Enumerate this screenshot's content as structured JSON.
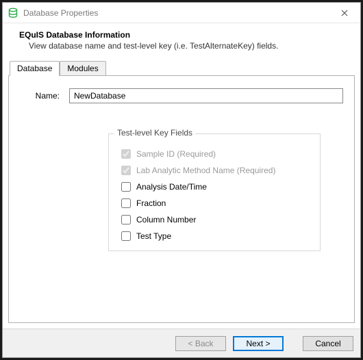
{
  "window": {
    "title": "Database Properties"
  },
  "header": {
    "title": "EQuIS Database Information",
    "subtitle": "View database name and test-level key (i.e. TestAlternateKey) fields."
  },
  "tabs": {
    "items": [
      {
        "label": "Database",
        "active": true
      },
      {
        "label": "Modules",
        "active": false
      }
    ]
  },
  "form": {
    "nameLabel": "Name:",
    "nameValue": "NewDatabase"
  },
  "keyFields": {
    "legend": "Test-level Key Fields",
    "items": [
      {
        "label": "Sample ID (Required)",
        "checked": true,
        "disabled": true
      },
      {
        "label": "Lab Analytic Method Name (Required)",
        "checked": true,
        "disabled": true
      },
      {
        "label": "Analysis Date/Time",
        "checked": false,
        "disabled": false
      },
      {
        "label": "Fraction",
        "checked": false,
        "disabled": false
      },
      {
        "label": "Column Number",
        "checked": false,
        "disabled": false
      },
      {
        "label": "Test Type",
        "checked": false,
        "disabled": false
      }
    ]
  },
  "buttons": {
    "back": "< Back",
    "next": "Next >",
    "cancel": "Cancel"
  }
}
